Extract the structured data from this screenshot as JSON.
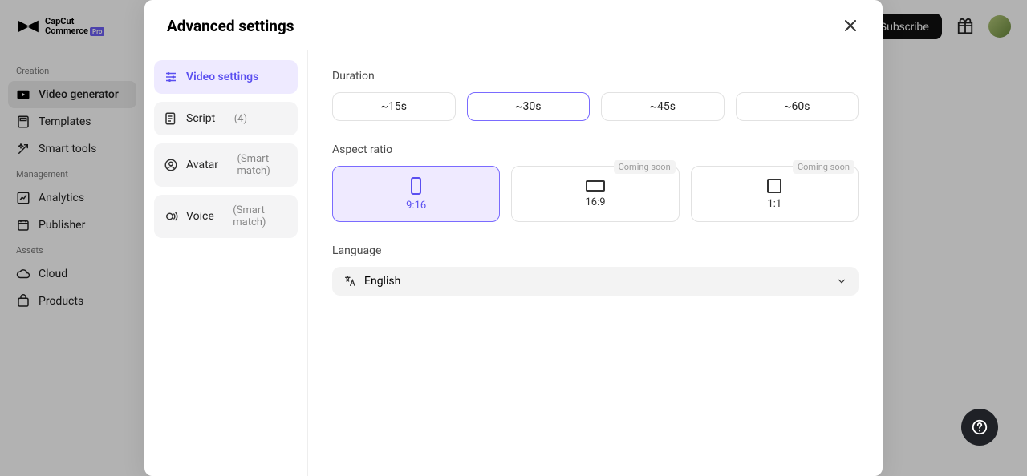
{
  "brand": {
    "line1": "CapCut",
    "line2": "Commerce",
    "badge": "Pro"
  },
  "topbar": {
    "subscribe_label": "Subscribe"
  },
  "sidebar": {
    "sections": {
      "creation": {
        "title": "Creation",
        "items": [
          {
            "label": "Video generator"
          },
          {
            "label": "Templates"
          },
          {
            "label": "Smart tools"
          }
        ]
      },
      "management": {
        "title": "Management",
        "items": [
          {
            "label": "Analytics"
          },
          {
            "label": "Publisher"
          }
        ]
      },
      "assets": {
        "title": "Assets",
        "items": [
          {
            "label": "Cloud"
          },
          {
            "label": "Products"
          }
        ]
      }
    }
  },
  "modal": {
    "title": "Advanced settings",
    "nav": [
      {
        "label": "Video settings",
        "meta": ""
      },
      {
        "label": "Script",
        "meta": "(4)"
      },
      {
        "label": "Avatar",
        "meta": "(Smart match)"
      },
      {
        "label": "Voice",
        "meta": "(Smart match)"
      }
    ],
    "duration": {
      "label": "Duration",
      "options": [
        "~15s",
        "~30s",
        "~45s",
        "~60s"
      ],
      "selected": "~30s"
    },
    "aspect": {
      "label": "Aspect ratio",
      "coming_soon": "Coming soon",
      "options": [
        {
          "label": "9:16"
        },
        {
          "label": "16:9"
        },
        {
          "label": "1:1"
        }
      ],
      "selected": "9:16"
    },
    "language": {
      "label": "Language",
      "selected": "English"
    }
  }
}
